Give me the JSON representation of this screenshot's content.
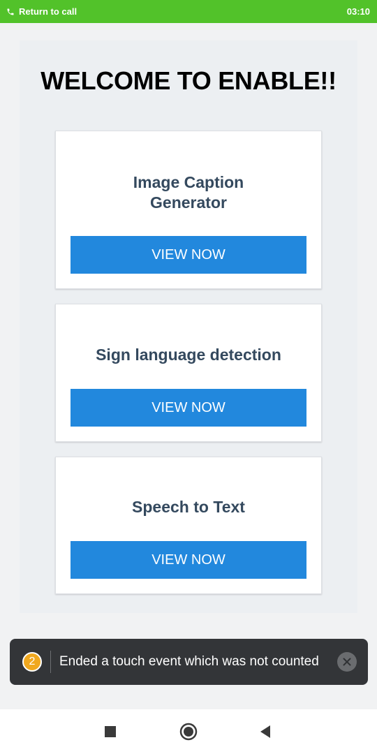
{
  "status_bar": {
    "return_label": "Return to call",
    "time": "03:10",
    "color": "#52c22a"
  },
  "main": {
    "title": "WELCOME TO ENABLE!!",
    "cards": [
      {
        "title": "Image Caption\nGenerator",
        "button_label": "VIEW NOW"
      },
      {
        "title": "Sign language detection",
        "button_label": "VIEW NOW"
      },
      {
        "title": "Speech to Text",
        "button_label": "VIEW NOW"
      }
    ],
    "accent_color": "#2288dd"
  },
  "toast": {
    "count": "2",
    "message": "Ended a touch event which was not counted",
    "close_icon": "close-icon"
  },
  "nav_bar": {
    "icons": [
      "recents-square-icon",
      "home-circle-icon",
      "back-triangle-icon"
    ]
  }
}
